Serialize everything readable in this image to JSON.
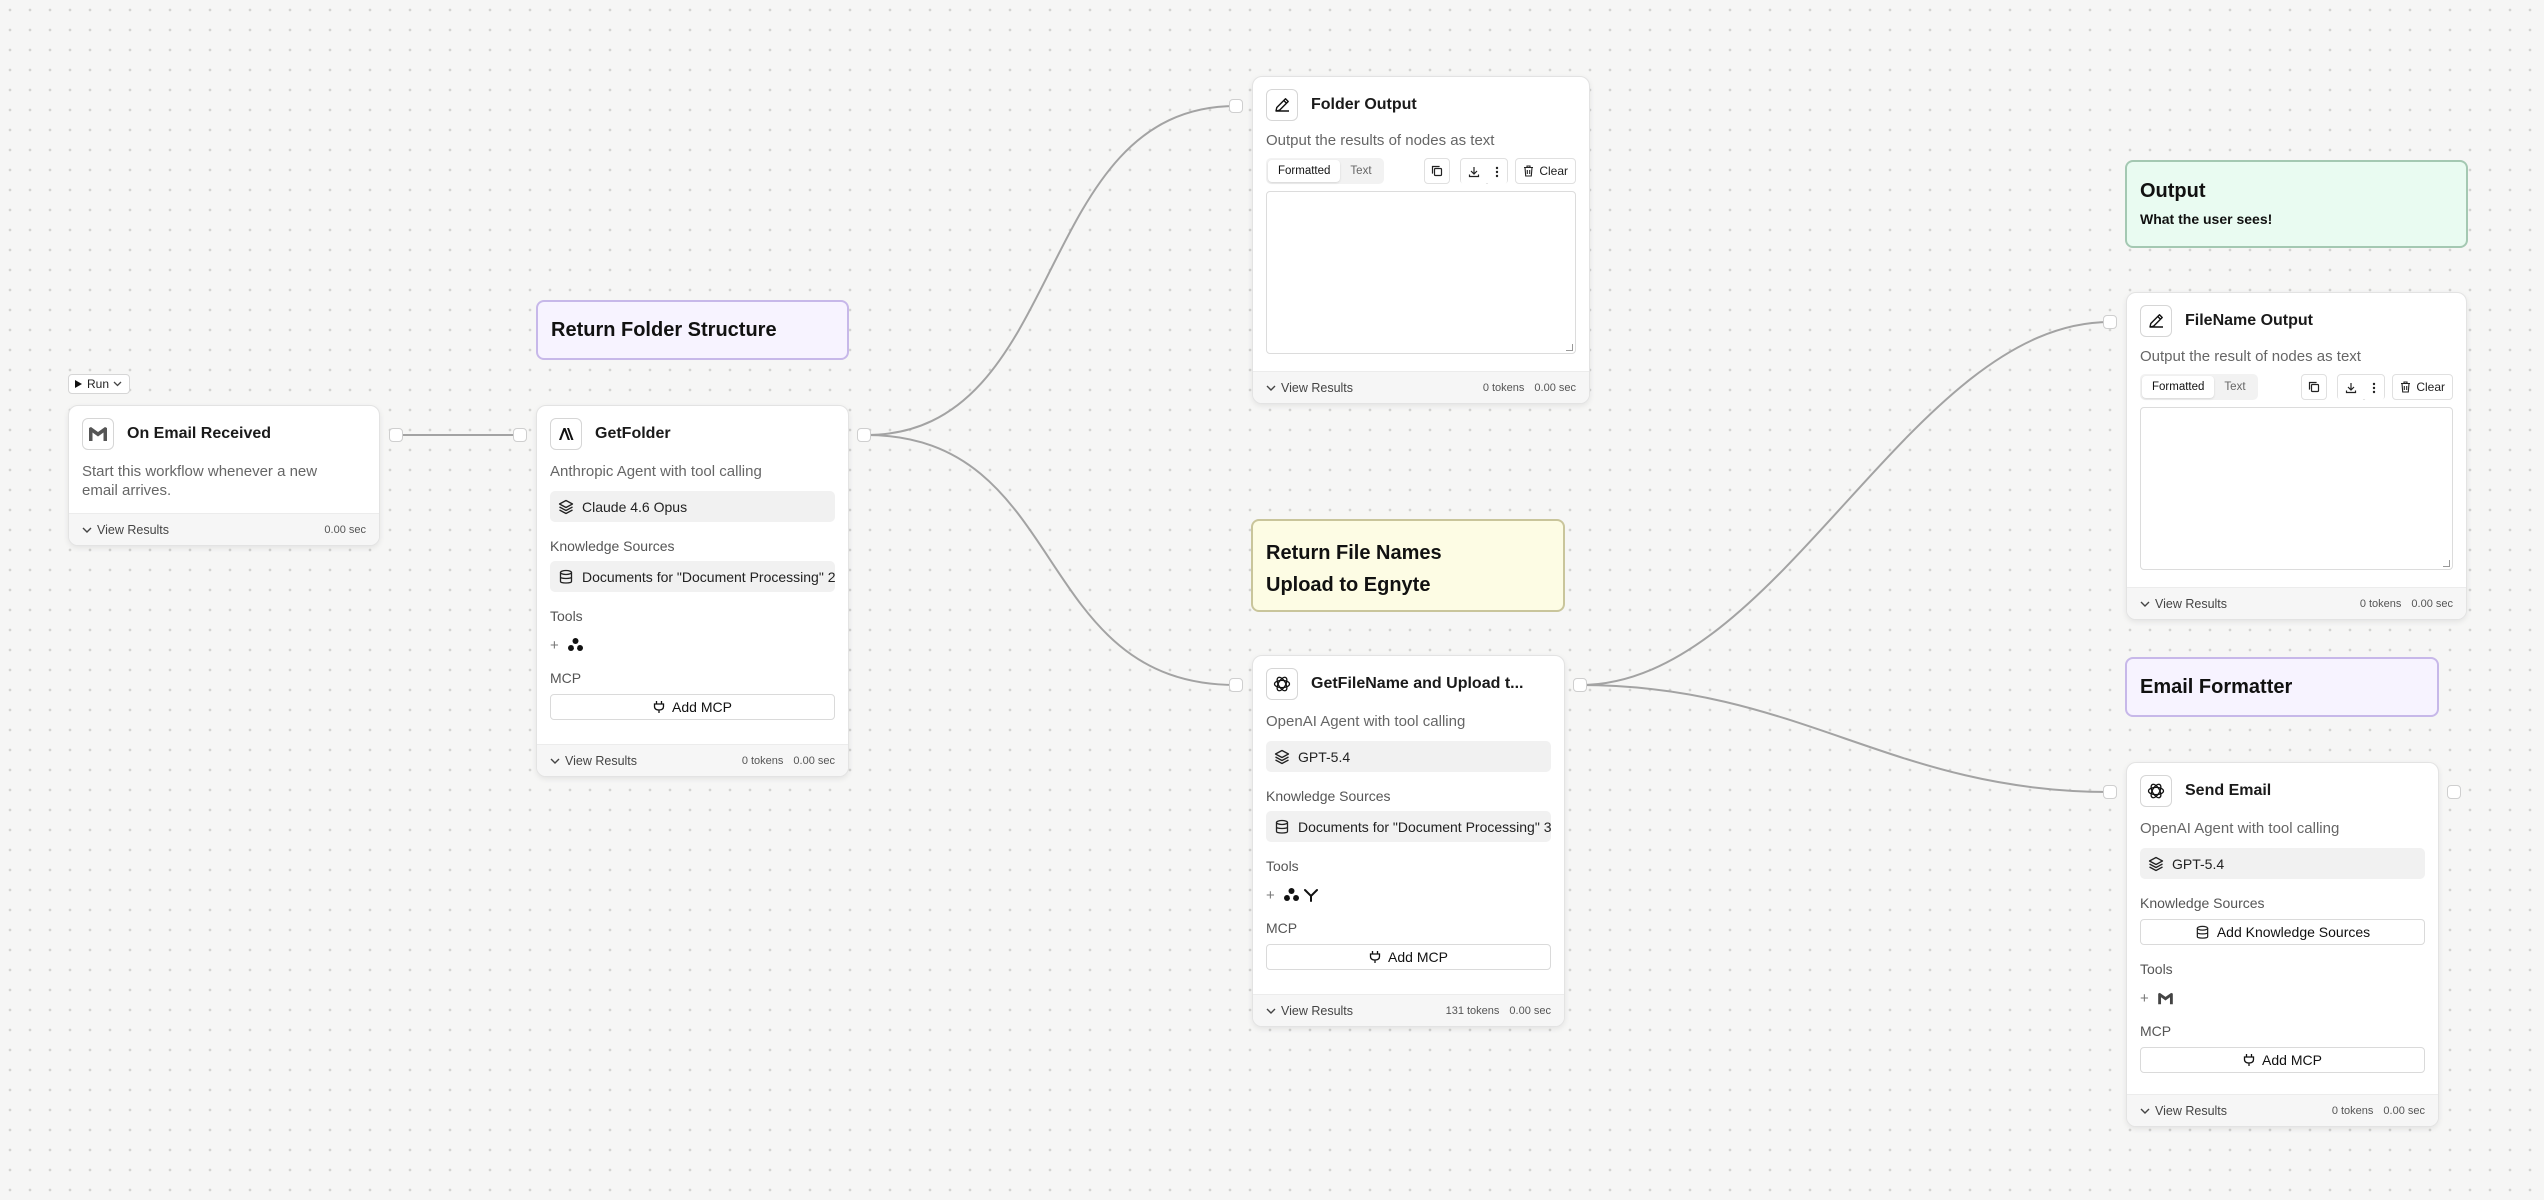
{
  "canvas": {
    "run_label": "Run",
    "notes": {
      "folder_structure": "Return Folder Structure",
      "file_names_line1": "Return File Names",
      "file_names_line2": "Upload to Egnyte",
      "output_title": "Output",
      "output_sub": "What the user sees!",
      "email_formatter": "Email Formatter"
    }
  },
  "common": {
    "view_results": "View Results",
    "knowledge_sources": "Knowledge Sources",
    "tools": "Tools",
    "mcp": "MCP",
    "add_mcp": "Add MCP",
    "formatted": "Formatted",
    "text": "Text",
    "clear": "Clear"
  },
  "nodes": {
    "email_trigger": {
      "title": "On Email Received",
      "desc": "Start this workflow whenever a new email arrives.",
      "time": "0.00 sec",
      "icon": "gmail-icon"
    },
    "get_folder": {
      "title": "GetFolder",
      "desc": "Anthropic Agent with tool calling",
      "model": "Claude 4.6 Opus",
      "knowledge": "Documents for \"Document Processing\" 2",
      "tokens": "0 tokens",
      "time": "0.00 sec",
      "icon": "anthropic-icon"
    },
    "folder_output": {
      "title": "Folder Output",
      "desc": "Output the results of nodes as text",
      "tokens": "0 tokens",
      "time": "0.00 sec",
      "icon": "pencil-icon"
    },
    "get_filename": {
      "title": "GetFileName and Upload t...",
      "desc": "OpenAI Agent with tool calling",
      "model": "GPT-5.4",
      "knowledge": "Documents for \"Document Processing\" 3",
      "tokens": "131 tokens",
      "time": "0.00 sec",
      "icon": "openai-icon"
    },
    "filename_output": {
      "title": "FileName Output",
      "desc": "Output the result of nodes as text",
      "tokens": "0 tokens",
      "time": "0.00 sec",
      "icon": "pencil-icon"
    },
    "send_email": {
      "title": "Send Email",
      "desc": "OpenAI Agent with tool calling",
      "model": "GPT-5.4",
      "knowledge_button": "Add Knowledge Sources",
      "tokens": "0 tokens",
      "time": "0.00 sec",
      "icon": "openai-icon"
    }
  }
}
